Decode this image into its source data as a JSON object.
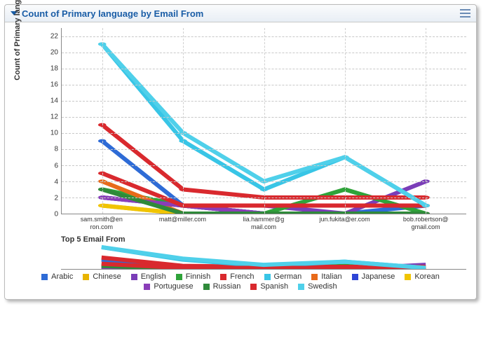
{
  "header": {
    "title": "Count of Primary language by Email From"
  },
  "ylabel": "Count of Primary language",
  "mini_label": "Top 5 Email From",
  "chart_data": {
    "type": "line",
    "title": "Count of Primary language by Email From",
    "xlabel": "",
    "ylabel": "Count of Primary language",
    "categories": [
      "sam.smith@enron.com",
      "matt@miller.com",
      "lia.hammer@gmail.com",
      "jun.fukita@er.com",
      "bob.robertson@gmail.com"
    ],
    "ylim": [
      0,
      23
    ],
    "yticks": [
      0,
      2,
      4,
      6,
      8,
      10,
      12,
      14,
      16,
      18,
      20,
      22
    ],
    "legend_position": "bottom",
    "grid": true,
    "series": [
      {
        "name": "Arabic",
        "color": "#2e6bd6",
        "values": [
          9,
          1,
          0,
          0,
          1
        ]
      },
      {
        "name": "Chinese",
        "color": "#e8b400",
        "values": [
          1,
          0,
          0,
          0,
          0
        ]
      },
      {
        "name": "English",
        "color": "#7a3db8",
        "values": [
          2,
          1,
          1,
          0,
          4
        ]
      },
      {
        "name": "Finnish",
        "color": "#2fa33a",
        "values": [
          3,
          1,
          0,
          3,
          0
        ]
      },
      {
        "name": "French",
        "color": "#d9292e",
        "values": [
          11,
          3,
          2,
          2,
          2
        ]
      },
      {
        "name": "German",
        "color": "#38c5e6",
        "values": [
          21,
          9,
          3,
          7,
          1
        ]
      },
      {
        "name": "Italian",
        "color": "#e86a1a",
        "values": [
          4,
          0,
          0,
          0,
          0
        ]
      },
      {
        "name": "Japanese",
        "color": "#2e45d6",
        "values": [
          2,
          1,
          0,
          0,
          0
        ]
      },
      {
        "name": "Korean",
        "color": "#f0c400",
        "values": [
          1,
          0,
          0,
          0,
          0
        ]
      },
      {
        "name": "Portuguese",
        "color": "#8a3db8",
        "values": [
          2,
          1,
          0,
          0,
          0
        ]
      },
      {
        "name": "Russian",
        "color": "#2f8a3a",
        "values": [
          3,
          0,
          0,
          0,
          0
        ]
      },
      {
        "name": "Spanish",
        "color": "#d9292e",
        "values": [
          5,
          1,
          1,
          1,
          1
        ]
      },
      {
        "name": "Swedish",
        "color": "#4fd0ea",
        "values": [
          21,
          10,
          4,
          7,
          1
        ]
      }
    ]
  }
}
